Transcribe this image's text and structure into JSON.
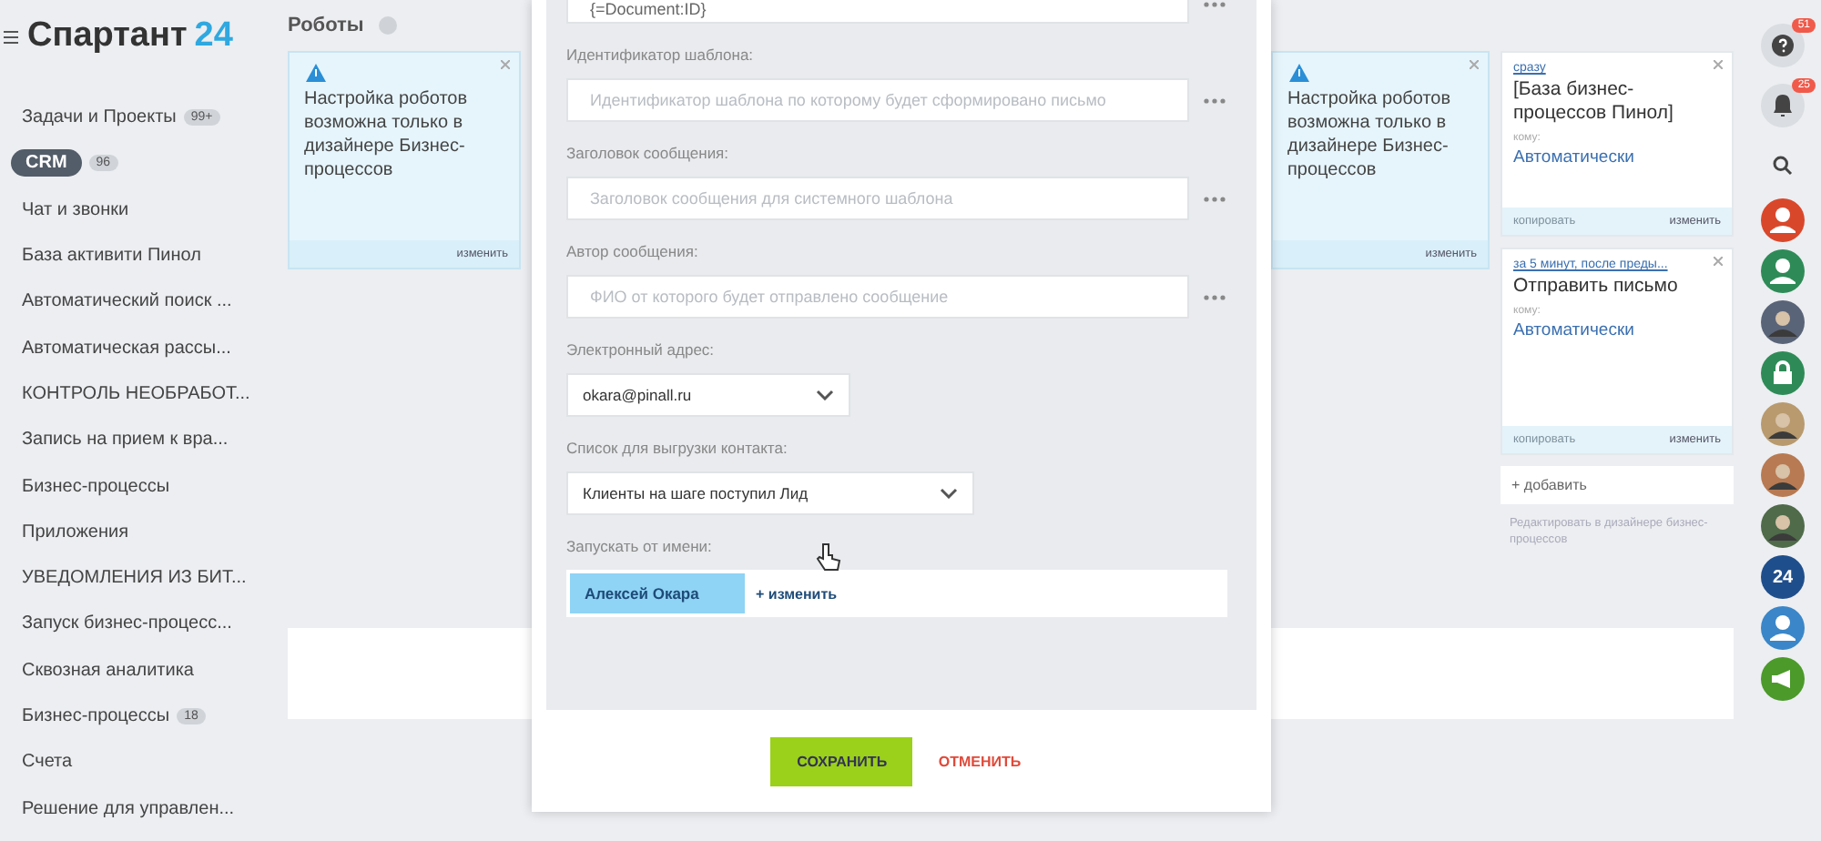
{
  "app": {
    "logo_text": "Спартант",
    "logo_number": "24"
  },
  "sidebar": {
    "items": [
      {
        "label": "Задачи и Проекты",
        "counter": "99+",
        "selected": false
      },
      {
        "label": "CRM",
        "counter": "96",
        "selected": true
      },
      {
        "label": "Чат и звонки",
        "selected": false
      },
      {
        "label": "База активити Пинол",
        "selected": false
      },
      {
        "label": "Автоматический поиск ...",
        "selected": false
      },
      {
        "label": "Автоматическая рассы...",
        "selected": false
      },
      {
        "label": "КОНТРОЛЬ НЕОБРАБОТ...",
        "selected": false
      },
      {
        "label": "Запись на прием к вра...",
        "selected": false
      },
      {
        "label": "Бизнес-процессы",
        "selected": false
      },
      {
        "label": "Приложения",
        "selected": false
      },
      {
        "label": "УВЕДОМЛЕНИЯ ИЗ БИТ...",
        "selected": false
      },
      {
        "label": "Запуск бизнес-процесс...",
        "selected": false
      },
      {
        "label": "Сквозная аналитика",
        "selected": false
      },
      {
        "label": "Бизнес-процессы",
        "counter": "18",
        "selected": false
      },
      {
        "label": "Счета",
        "selected": false
      },
      {
        "label": "Решение для управлен...",
        "selected": false
      }
    ]
  },
  "page": {
    "title": "Роботы"
  },
  "columns": [
    {
      "cards": [
        {
          "kind": "warning",
          "text": "Настройка роботов возможна только в дизайнере Бизнес-процессов",
          "action": "изменить"
        }
      ]
    },
    {
      "cards": [
        {
          "kind": "warning",
          "text": "Настройка роботов возможна только в дизайнере Бизнес-процессов",
          "action": "изменить"
        }
      ]
    },
    {
      "cards": [
        {
          "kind": "robot",
          "trigger": "сразу",
          "title": "[База бизнес-процессов Пинол]",
          "recipient_label": "кому:",
          "recipient": "Автоматически",
          "secondary_action": "копировать",
          "action": "изменить"
        },
        {
          "kind": "robot",
          "trigger": "за 5 минут, после преды...",
          "title": "Отправить письмо",
          "recipient_label": "кому:",
          "recipient": "Автоматически",
          "secondary_action": "копировать",
          "action": "изменить"
        }
      ],
      "add_label": "+ добавить",
      "hint": "Редактировать в дизайнере бизнес-процессов"
    }
  ],
  "modal": {
    "top_value": "{=Document:ID}",
    "fields": [
      {
        "kind": "text",
        "label": "Идентификатор шаблона:",
        "placeholder": "Идентификатор шаблона по которому будет сформировано письмо"
      },
      {
        "kind": "text",
        "label": "Заголовок сообщения:",
        "placeholder": "Заголовок сообщения для системного шаблона"
      },
      {
        "kind": "text",
        "label": "Автор сообщения:",
        "placeholder": "ФИО от которого будет отправлено сообщение"
      },
      {
        "kind": "select",
        "label": "Электронный адрес:",
        "value": "okara@pinall.ru",
        "wide": false
      },
      {
        "kind": "select",
        "label": "Список для выгрузки контакта:",
        "value": "Клиенты на шаге поступил Лид",
        "wide": true
      },
      {
        "kind": "user",
        "label": "Запускать от имени:",
        "user": "Алексей Окара",
        "action": "+ изменить"
      }
    ],
    "buttons": [
      {
        "kind": "primary",
        "label": "СОХРАНИТЬ"
      },
      {
        "kind": "cancel",
        "label": "ОТМЕНИТЬ"
      }
    ]
  },
  "rail": {
    "items": [
      {
        "kind": "help",
        "badge": "51"
      },
      {
        "kind": "bell",
        "badge": "25"
      },
      {
        "kind": "search"
      },
      {
        "kind": "person",
        "color": "#d9472b"
      },
      {
        "kind": "person",
        "color": "#2e8b57"
      },
      {
        "kind": "photo",
        "color": "#5a6478"
      },
      {
        "kind": "lock",
        "color": "#2e8b57"
      },
      {
        "kind": "photo",
        "color": "#b89a6e"
      },
      {
        "kind": "photo",
        "color": "#b87a52"
      },
      {
        "kind": "photo",
        "color": "#4f6b4a"
      },
      {
        "kind": "number",
        "color": "#1f4e8c",
        "text": "24"
      },
      {
        "kind": "person",
        "color": "#3a86c8"
      },
      {
        "kind": "megaphone",
        "color": "#4c9a2a"
      }
    ]
  }
}
